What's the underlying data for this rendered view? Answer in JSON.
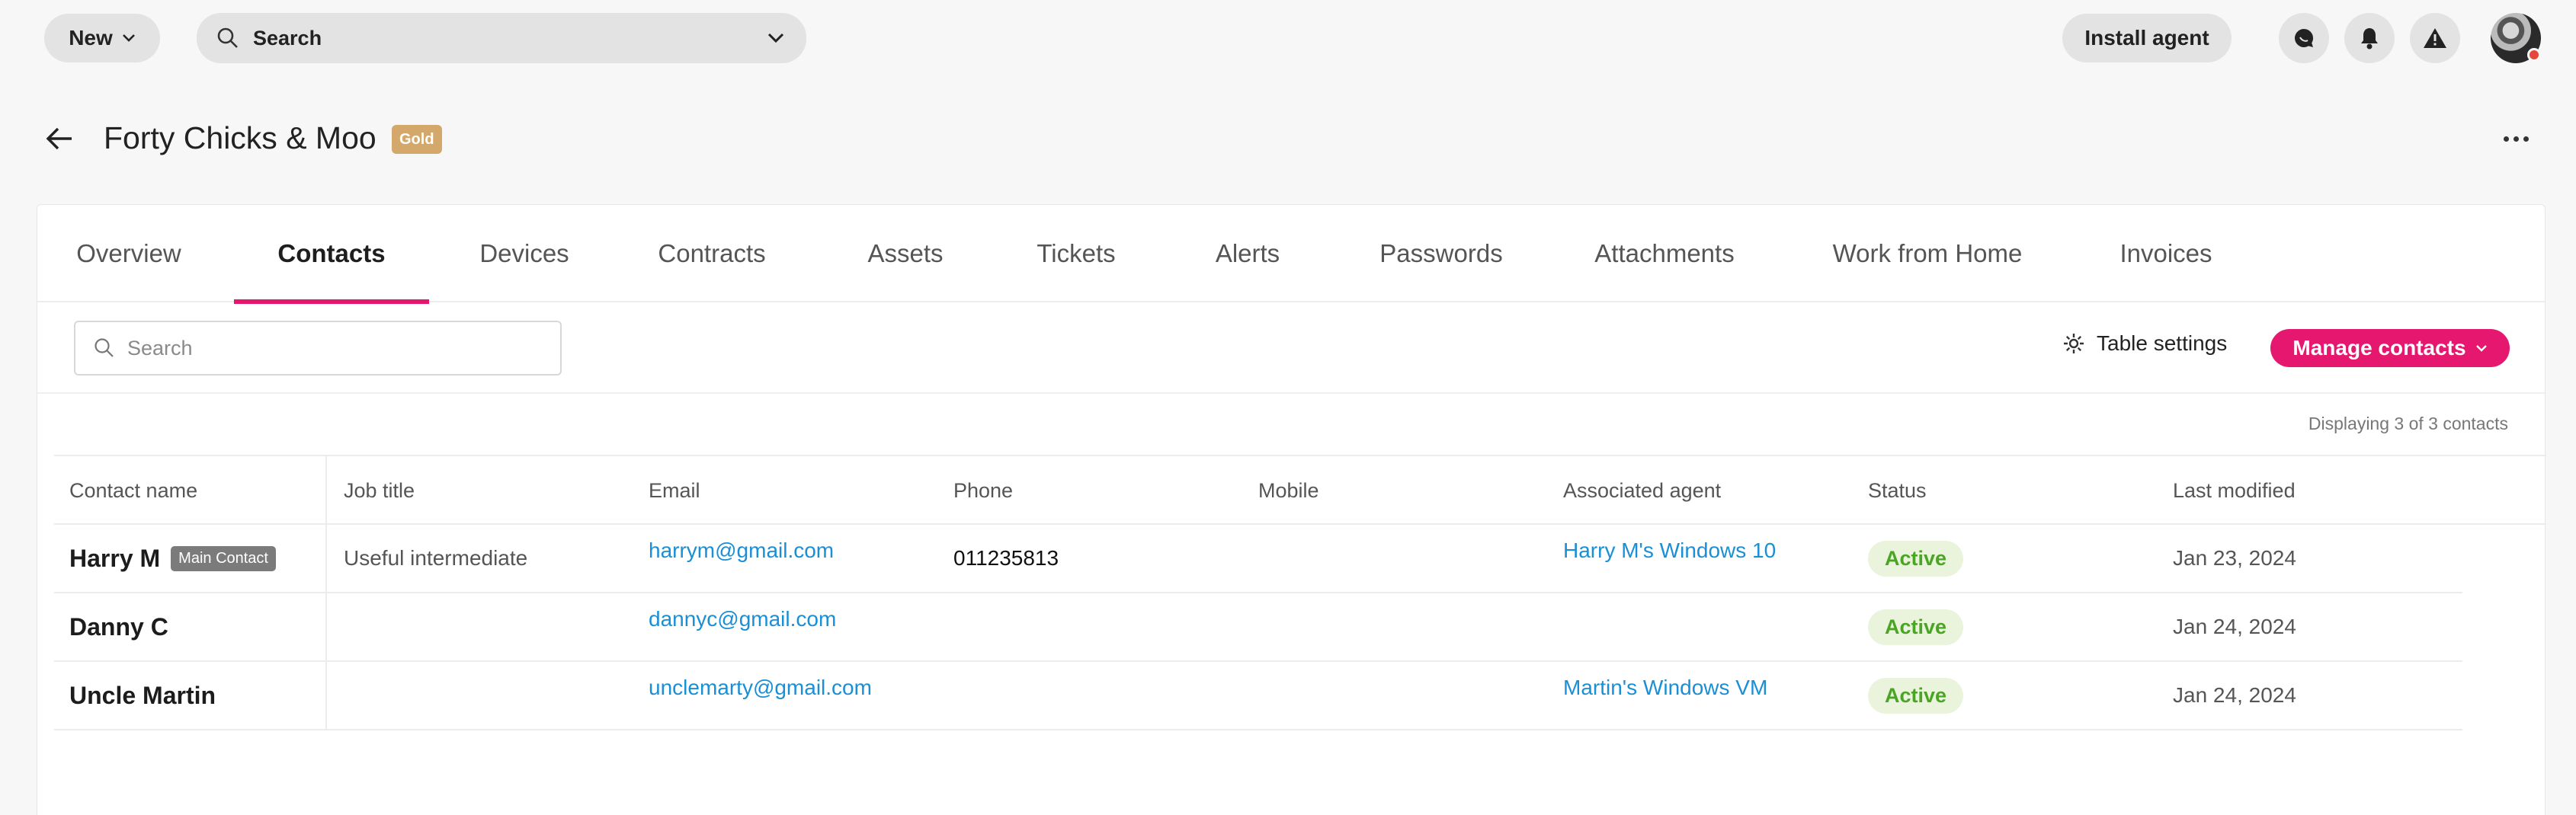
{
  "topbar": {
    "new_label": "New",
    "search_label": "Search",
    "install_label": "Install agent"
  },
  "header": {
    "title": "Forty Chicks & Moo",
    "tier_badge": "Gold"
  },
  "tabs": [
    {
      "label": "Overview"
    },
    {
      "label": "Contacts"
    },
    {
      "label": "Devices"
    },
    {
      "label": "Contracts"
    },
    {
      "label": "Assets"
    },
    {
      "label": "Tickets"
    },
    {
      "label": "Alerts"
    },
    {
      "label": "Passwords"
    },
    {
      "label": "Attachments"
    },
    {
      "label": "Work from Home"
    },
    {
      "label": "Invoices"
    }
  ],
  "active_tab": "Contacts",
  "toolbar": {
    "search_placeholder": "Search",
    "table_settings_label": "Table settings",
    "manage_label": "Manage contacts"
  },
  "displaying": "Displaying 3 of 3 contacts",
  "columns": [
    "Contact name",
    "Job title",
    "Email",
    "Phone",
    "Mobile",
    "Associated agent",
    "Status",
    "Last modified"
  ],
  "rows": [
    {
      "name": "Harry M",
      "tag": "Main Contact",
      "job": "Useful intermediate",
      "email": "harrym@gmail.com",
      "phone": "011235813",
      "mobile": "",
      "agent": "Harry M's Windows 10",
      "status": "Active",
      "modified": "Jan 23, 2024"
    },
    {
      "name": "Danny C",
      "tag": "",
      "job": "",
      "email": "dannyc@gmail.com",
      "phone": "",
      "mobile": "",
      "agent": "",
      "status": "Active",
      "modified": "Jan 24, 2024"
    },
    {
      "name": "Uncle Martin",
      "tag": "",
      "job": "",
      "email": "unclemarty@gmail.com",
      "phone": "",
      "mobile": "",
      "agent": "Martin's Windows VM",
      "status": "Active",
      "modified": "Jan 24, 2024"
    }
  ],
  "colors": {
    "accent": "#e5176f",
    "link": "#1a8fd6",
    "status_active": "#4aa524",
    "gold": "#d4a86a"
  }
}
